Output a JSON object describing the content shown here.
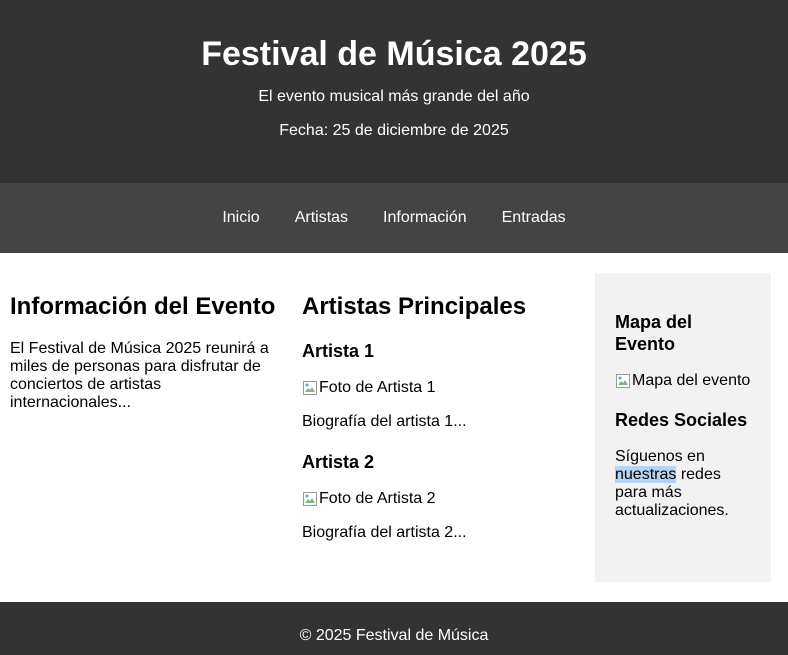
{
  "header": {
    "title": "Festival de Música 2025",
    "tagline": "El evento musical más grande del año",
    "date": "Fecha: 25 de diciembre de 2025"
  },
  "nav": {
    "items": [
      {
        "label": "Inicio"
      },
      {
        "label": "Artistas"
      },
      {
        "label": "Información"
      },
      {
        "label": "Entradas"
      }
    ]
  },
  "info": {
    "heading": "Información del Evento",
    "text": "El Festival de Música 2025 reunirá a miles de personas para disfrutar de conciertos de artistas internacionales..."
  },
  "artists": {
    "heading": "Artistas Principales",
    "items": [
      {
        "name": "Artista 1",
        "photo_alt": "Foto de Artista 1",
        "bio": "Biografía del artista 1..."
      },
      {
        "name": "Artista 2",
        "photo_alt": "Foto de Artista 2",
        "bio": "Biografía del artista 2..."
      }
    ]
  },
  "sidebar": {
    "map_heading": "Mapa del Evento",
    "map_alt": "Mapa del evento",
    "social_heading": "Redes Sociales",
    "social_text_before": "Síguenos en ",
    "social_text_highlight": "nuestras",
    "social_text_after": " redes para más actualizaciones."
  },
  "footer": {
    "text": "© 2025 Festival de Música"
  },
  "colors": {
    "header_bg": "#333333",
    "nav_bg": "#444444",
    "sidebar_bg": "#f2f2f2",
    "selection": "#b3d4f5"
  }
}
